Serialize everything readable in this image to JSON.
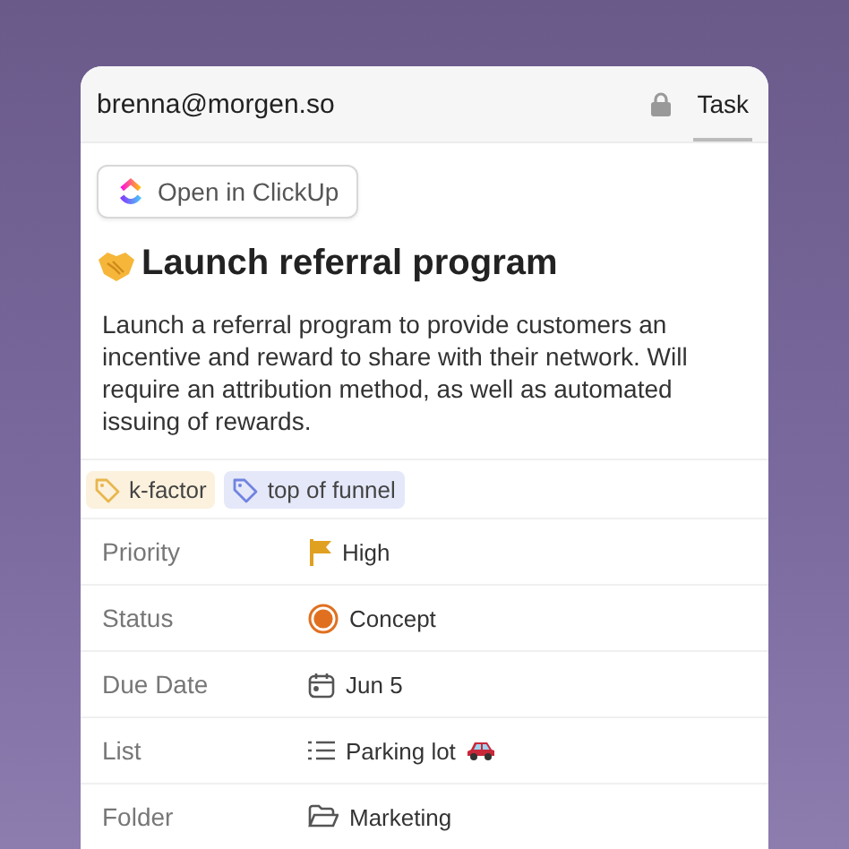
{
  "header": {
    "account": "brenna@morgen.so",
    "locked": true,
    "tabs": [
      {
        "label": "Task",
        "selected": true
      }
    ]
  },
  "open_button": {
    "label": "Open in ClickUp"
  },
  "task": {
    "title": "Launch referral program",
    "description": "Launch a referral program to provide customers an incentive and reward to share with their network. Will require an attribution method, as well as automated issuing of rewards."
  },
  "tags": [
    {
      "label": "k-factor",
      "color": "#e8b64c"
    },
    {
      "label": "top of funnel",
      "color": "#7083e0"
    }
  ],
  "fields": [
    {
      "label": "Priority",
      "kind": "priority",
      "value": "High",
      "color": "#e0a020"
    },
    {
      "label": "Status",
      "kind": "status",
      "value": "Concept",
      "color": "#e07020"
    },
    {
      "label": "Due Date",
      "kind": "date",
      "value": "Jun 5"
    },
    {
      "label": "List",
      "kind": "list",
      "value": "Parking lot"
    },
    {
      "label": "Folder",
      "kind": "folder",
      "value": "Marketing"
    }
  ]
}
